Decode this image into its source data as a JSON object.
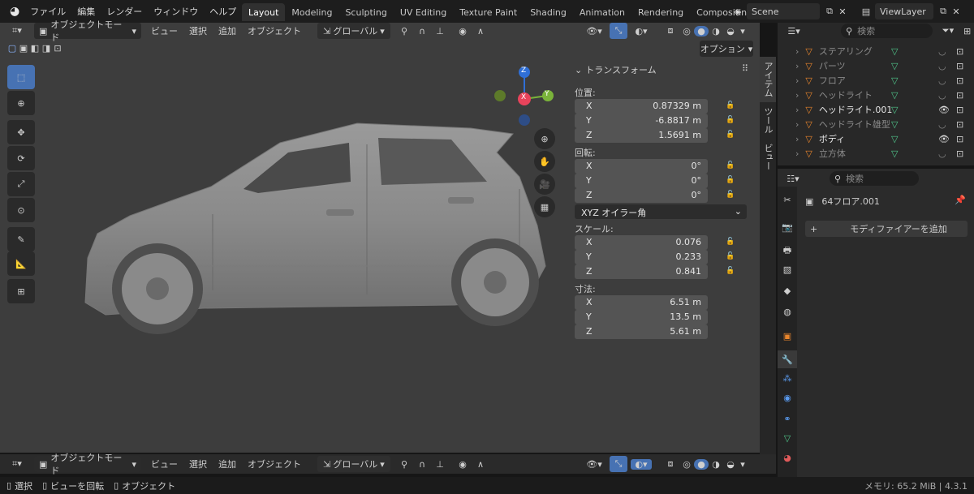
{
  "app": {
    "logo": "blender-logo"
  },
  "menu": [
    "ファイル",
    "編集",
    "レンダー",
    "ウィンドウ",
    "ヘルプ"
  ],
  "workspaces": [
    "Layout",
    "Modeling",
    "Sculpting",
    "UV Editing",
    "Texture Paint",
    "Shading",
    "Animation",
    "Rendering",
    "Compositing"
  ],
  "active_workspace": "Layout",
  "scene": {
    "name": "Scene",
    "viewlayer": "ViewLayer"
  },
  "viewport": {
    "mode": "オブジェクトモード",
    "menus": [
      "ビュー",
      "選択",
      "追加",
      "オブジェクト"
    ],
    "orientation": "グローバル",
    "options": "オプション",
    "gizmo": {
      "z": "Z",
      "y": "Y",
      "x": "X"
    },
    "object": "car-model"
  },
  "npanel": {
    "tabs": [
      "アイテム",
      "ツール",
      "ビュー"
    ],
    "title": "トランスフォーム",
    "location_label": "位置:",
    "location": [
      {
        "ax": "X",
        "v": "0.87329 m"
      },
      {
        "ax": "Y",
        "v": "-6.8817 m"
      },
      {
        "ax": "Z",
        "v": "1.5691 m"
      }
    ],
    "rotation_label": "回転:",
    "rotation": [
      {
        "ax": "X",
        "v": "0°"
      },
      {
        "ax": "Y",
        "v": "0°"
      },
      {
        "ax": "Z",
        "v": "0°"
      }
    ],
    "rotation_mode": "XYZ オイラー角",
    "scale_label": "スケール:",
    "scale": [
      {
        "ax": "X",
        "v": "0.076"
      },
      {
        "ax": "Y",
        "v": "0.233"
      },
      {
        "ax": "Z",
        "v": "0.841"
      }
    ],
    "dimensions_label": "寸法:",
    "dimensions": [
      {
        "ax": "X",
        "v": "6.51 m"
      },
      {
        "ax": "Y",
        "v": "13.5 m"
      },
      {
        "ax": "Z",
        "v": "5.61 m"
      }
    ]
  },
  "outliner": {
    "search_placeholder": "検索",
    "items": [
      {
        "name": "ステアリング",
        "dim": true
      },
      {
        "name": "パーツ",
        "dim": true
      },
      {
        "name": "フロア",
        "dim": true
      },
      {
        "name": "ヘッドライト",
        "dim": true
      },
      {
        "name": "ヘッドライト.001",
        "dim": false
      },
      {
        "name": "ヘッドライト雄型",
        "dim": true
      },
      {
        "name": "ボディ",
        "dim": false
      },
      {
        "name": "立方体",
        "dim": true
      }
    ]
  },
  "properties": {
    "search_placeholder": "検索",
    "object_name": "64フロア.001",
    "add_modifier": "モディファイアーを追加"
  },
  "bottom": {
    "mode": "オブジェクトモード",
    "menus": [
      "ビュー",
      "選択",
      "追加",
      "オブジェクト"
    ],
    "orientation": "グローバル"
  },
  "status": {
    "select": "選択",
    "rotate": "ビューを回転",
    "object": "オブジェクト",
    "memory": "メモリ: 65.2 MiB | 4.3.1"
  }
}
